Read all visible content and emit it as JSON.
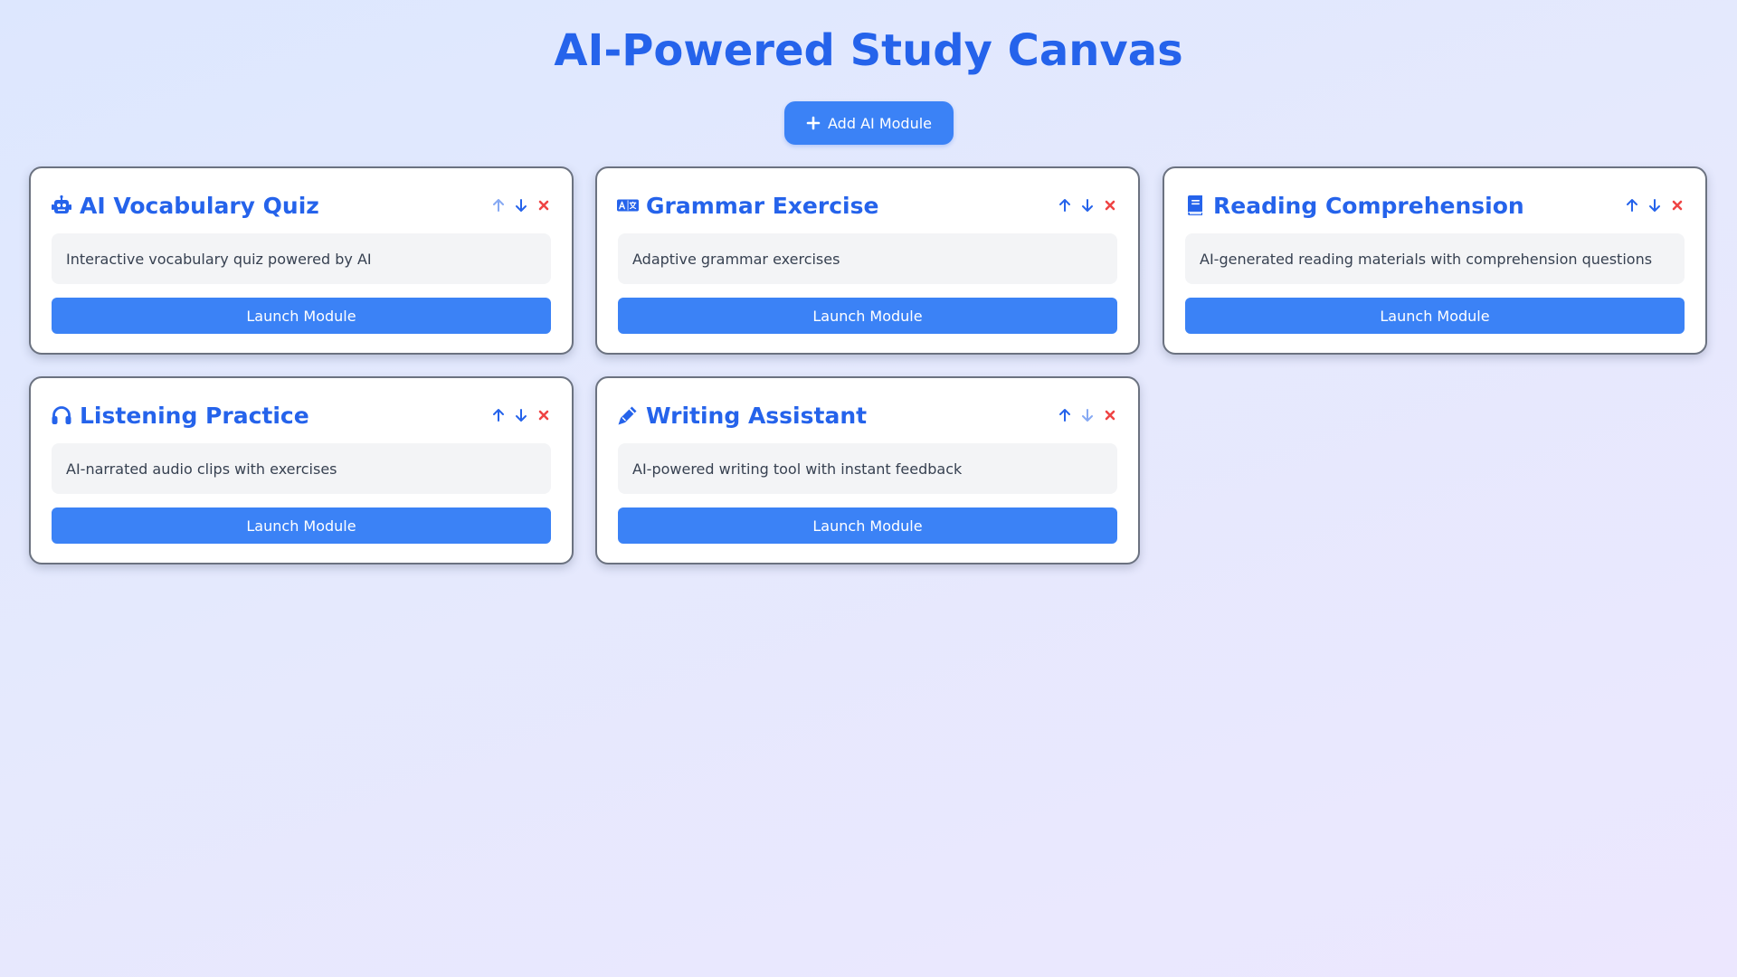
{
  "page": {
    "title": "AI-Powered Study Canvas"
  },
  "toolbar": {
    "add_label": "Add AI Module"
  },
  "colors": {
    "accent": "#2563eb",
    "button": "#3b82f6",
    "remove": "#ef4444"
  },
  "modules": [
    {
      "icon": "robot-icon",
      "title": "AI Vocabulary Quiz",
      "description": "Interactive vocabulary quiz powered by AI",
      "launch_label": "Launch Module",
      "move_up_enabled": false,
      "move_down_enabled": true
    },
    {
      "icon": "language-icon",
      "title": "Grammar Exercise",
      "description": "Adaptive grammar exercises",
      "launch_label": "Launch Module",
      "move_up_enabled": true,
      "move_down_enabled": true
    },
    {
      "icon": "book-icon",
      "title": "Reading Comprehension",
      "description": "AI-generated reading materials with comprehension questions",
      "launch_label": "Launch Module",
      "move_up_enabled": true,
      "move_down_enabled": true
    },
    {
      "icon": "headphones-icon",
      "title": "Listening Practice",
      "description": "AI-narrated audio clips with exercises",
      "launch_label": "Launch Module",
      "move_up_enabled": true,
      "move_down_enabled": true
    },
    {
      "icon": "pencil-icon",
      "title": "Writing Assistant",
      "description": "AI-powered writing tool with instant feedback",
      "launch_label": "Launch Module",
      "move_up_enabled": true,
      "move_down_enabled": false
    }
  ]
}
